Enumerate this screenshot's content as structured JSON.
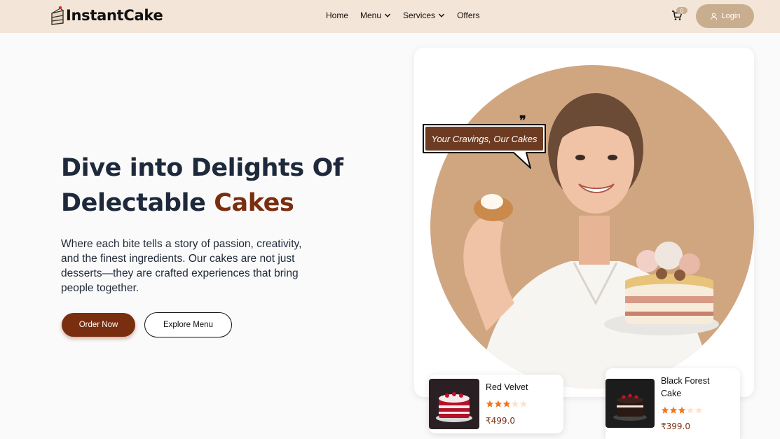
{
  "brand": {
    "name": "InstantCake"
  },
  "nav": {
    "links": [
      {
        "label": "Home",
        "has_dropdown": false
      },
      {
        "label": "Menu",
        "has_dropdown": true
      },
      {
        "label": "Services",
        "has_dropdown": true
      },
      {
        "label": "Offers",
        "has_dropdown": false
      }
    ],
    "cart_count": "0",
    "login_label": "Login"
  },
  "hero": {
    "title_line1": "Dive into Delights Of",
    "title_line2_plain": "Delectable ",
    "title_line2_accent": "Cakes",
    "description": "Where each bite tells a story of passion, creativity, and the finest ingredients. Our cakes are not just desserts—they are crafted experiences that bring people together.",
    "order_button": "Order Now",
    "explore_button": "Explore Menu",
    "speech_bubble": "Your Cravings, Our Cakes",
    "quote_mark": "❞"
  },
  "products": [
    {
      "name": "Red Velvet",
      "rating": 3,
      "max_rating": 5,
      "price": "₹499.0"
    },
    {
      "name": "Black Forest Cake",
      "rating": 3,
      "max_rating": 5,
      "price": "₹399.0"
    }
  ],
  "colors": {
    "nav_bg": "#f3e5d7",
    "accent_brown": "#7a2e10",
    "tan": "#c8ae8f",
    "circle": "#d0a681",
    "star_filled": "#f97316",
    "star_empty": "#fde2cf"
  }
}
